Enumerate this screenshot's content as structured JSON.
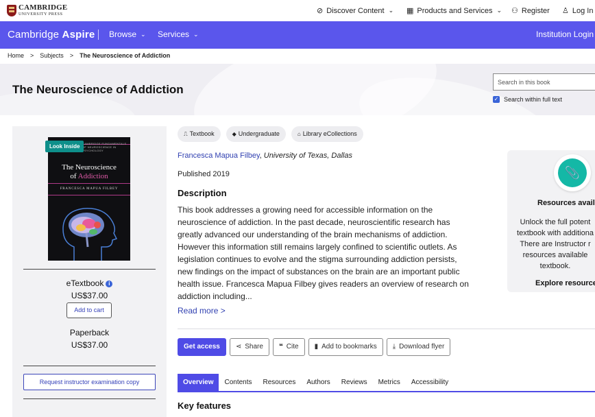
{
  "header": {
    "logo_line1": "CAMBRIDGE",
    "logo_line2": "UNIVERSITY PRESS",
    "discover": "Discover Content",
    "products": "Products and Services",
    "register": "Register",
    "login": "Log In"
  },
  "nav": {
    "brand_light": "Cambridge",
    "brand_bold": "Aspire",
    "browse": "Browse",
    "services": "Services",
    "institution_login": "Institution Login"
  },
  "breadcrumb": {
    "home": "Home",
    "subjects": "Subjects",
    "current": "The Neuroscience of Addiction"
  },
  "hero": {
    "title": "The Neuroscience of Addiction",
    "search_placeholder": "Search in this book",
    "search_full_text": "Search within full text"
  },
  "book": {
    "look_inside": "Look Inside",
    "cover_series": "CAMBRIDGE FUNDAMENTALS OF NEUROSCIENCE IN PSYCHOLOGY",
    "cover_title_1": "The Neuroscience",
    "cover_title_2a": "of ",
    "cover_title_2b": "Addiction",
    "cover_author": "FRANCESCA MAPUA FILBEY"
  },
  "purchase": {
    "etextbook_label": "eTextbook",
    "etextbook_price": "US$37.00",
    "add_to_cart": "Add to cart",
    "paperback_label": "Paperback",
    "paperback_price": "US$37.00",
    "request_copy": "Request instructor examination copy"
  },
  "tags": [
    "Textbook",
    "Undergraduate",
    "Library eCollections"
  ],
  "details": {
    "author": "Francesca Mapua Filbey",
    "affiliation": "University of Texas, Dallas",
    "published": "Published 2019",
    "description_heading": "Description",
    "description_lines": [
      "This book addresses a growing need for accessible information on the",
      "neuroscience of addiction. In the past decade, neuroscientific research has",
      "greatly advanced our understanding of the brain mechanisms of addiction.",
      "However this information still remains largely confined to scientific outlets. As",
      "legislation continues to evolve and the stigma surrounding addiction persists,",
      "new findings on the impact of substances on the brain are an important public",
      "health issue. Francesca Mapua Filbey gives readers an overview of research on",
      "addiction including..."
    ],
    "read_more": "Read more >"
  },
  "actions": {
    "get_access": "Get access",
    "share": "Share",
    "cite": "Cite",
    "bookmarks": "Add to bookmarks",
    "download": "Download flyer"
  },
  "tabs": [
    "Overview",
    "Contents",
    "Resources",
    "Authors",
    "Reviews",
    "Metrics",
    "Accessibility"
  ],
  "key_features": "Key features",
  "resources_card": {
    "title": "Resources availa",
    "lines": [
      "Unlock the full potent",
      "textbook with additiona",
      "There are Instructor r",
      "resources available",
      "textbook."
    ],
    "explore": "Explore resource"
  },
  "colors": {
    "brand_blue": "#5a56ec",
    "button_primary": "#4f4be6",
    "teal": "#14b8a6",
    "link": "#2f3fb0"
  }
}
